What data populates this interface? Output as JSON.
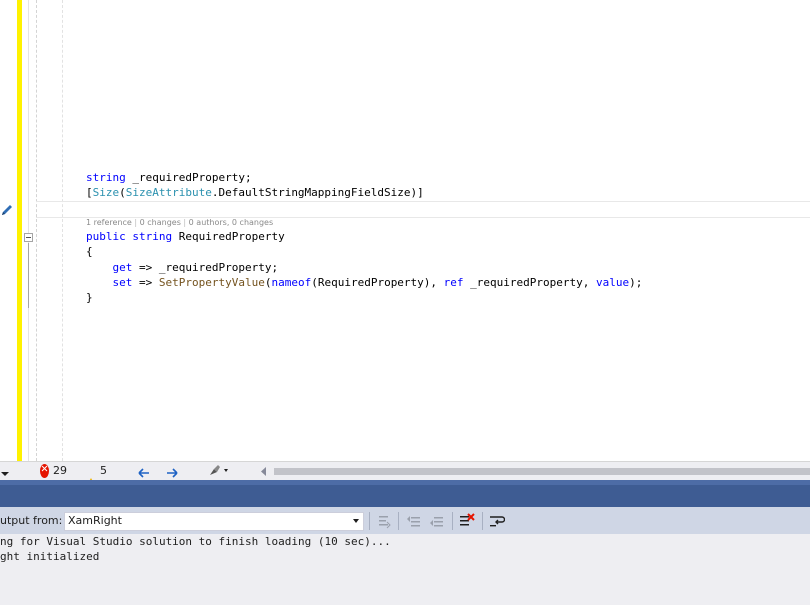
{
  "editor": {
    "code": {
      "line1": {
        "type": "string",
        "rest": " _requiredProperty;"
      },
      "line2": {
        "open": "[",
        "attr": "Size",
        "paren_open": "(",
        "type": "SizeAttribute",
        "member": ".DefaultStringMappingFieldSize",
        "close": ")]"
      },
      "codelens": {
        "references": "1 reference",
        "changes": "0 changes",
        "authors": "0 authors, 0 changes",
        "separator": " | "
      },
      "line3": {
        "kw1": "public",
        "kw2": "string",
        "name": " RequiredProperty"
      },
      "line4": "{",
      "line5": {
        "kw": "get",
        "rest": " => _requiredProperty;"
      },
      "line6": {
        "kw": "set",
        "arrow": " => ",
        "method": "SetPropertyValue",
        "p1": "(",
        "nameof": "nameof",
        "p2": "(RequiredProperty), ",
        "ref": "ref",
        "p3": " _requiredProperty, ",
        "value": "value",
        "p4": ");"
      },
      "line7": "}"
    }
  },
  "status": {
    "error_count": "29",
    "warning_count": "5"
  },
  "output": {
    "show_from_label": "utput from:",
    "source_selected": "XamRight",
    "lines": [
      "ng for Visual Studio solution to finish loading (10 sec)...",
      "ght initialized"
    ]
  },
  "colors": {
    "keyword": "#0000ff",
    "type": "#2b91af",
    "method": "#74531f",
    "change_marker": "#fff200",
    "tool_window_band": "#3e5c93",
    "error": "#e51400",
    "warning": "#f0b400"
  }
}
